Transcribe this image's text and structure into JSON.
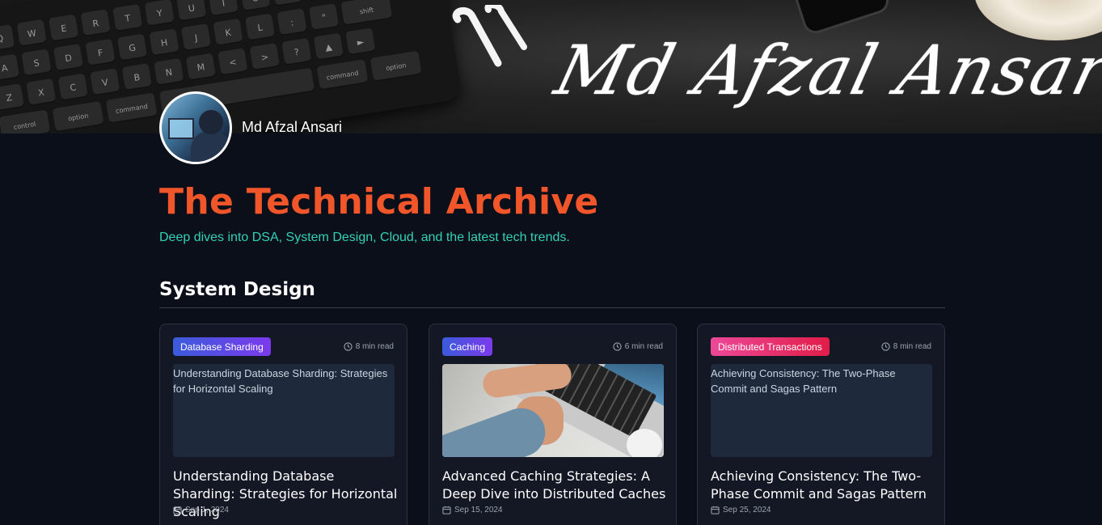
{
  "banner": {
    "signature": "Md  Afzal Ansari"
  },
  "author": {
    "name": "Md Afzal Ansari"
  },
  "header": {
    "title": "The Technical Archive",
    "subtitle": "Deep dives into DSA, System Design, Cloud, and the latest tech trends."
  },
  "section": {
    "title": "System Design"
  },
  "colors": {
    "title": "#f0562a",
    "subtitle": "#34d1b6",
    "background": "#0b0f19",
    "card": "#131824"
  },
  "posts": [
    {
      "tag": "Database Sharding",
      "tag_colors": [
        "#3b5bdb",
        "#7c3aed"
      ],
      "read_time": "8 min read",
      "thumbnail_alt": "Understanding Database Sharding: Strategies for Horizontal Scaling",
      "title": "Understanding Database Sharding: Strategies for Horizontal Scaling",
      "date": "Sep 1, 2024"
    },
    {
      "tag": "Caching",
      "tag_colors": [
        "#3b5bdb",
        "#7c3aed"
      ],
      "read_time": "6 min read",
      "thumbnail_alt": "",
      "title": "Advanced Caching Strategies: A Deep Dive into Distributed Caches",
      "date": "Sep 15, 2024"
    },
    {
      "tag": "Distributed Transactions",
      "tag_colors": [
        "#ec4899",
        "#e11d48"
      ],
      "read_time": "8 min read",
      "thumbnail_alt": "Achieving Consistency: The Two-Phase Commit and Sagas Pattern",
      "title": "Achieving Consistency: The Two-Phase Commit and Sagas Pattern",
      "date": "Sep 25, 2024"
    }
  ]
}
